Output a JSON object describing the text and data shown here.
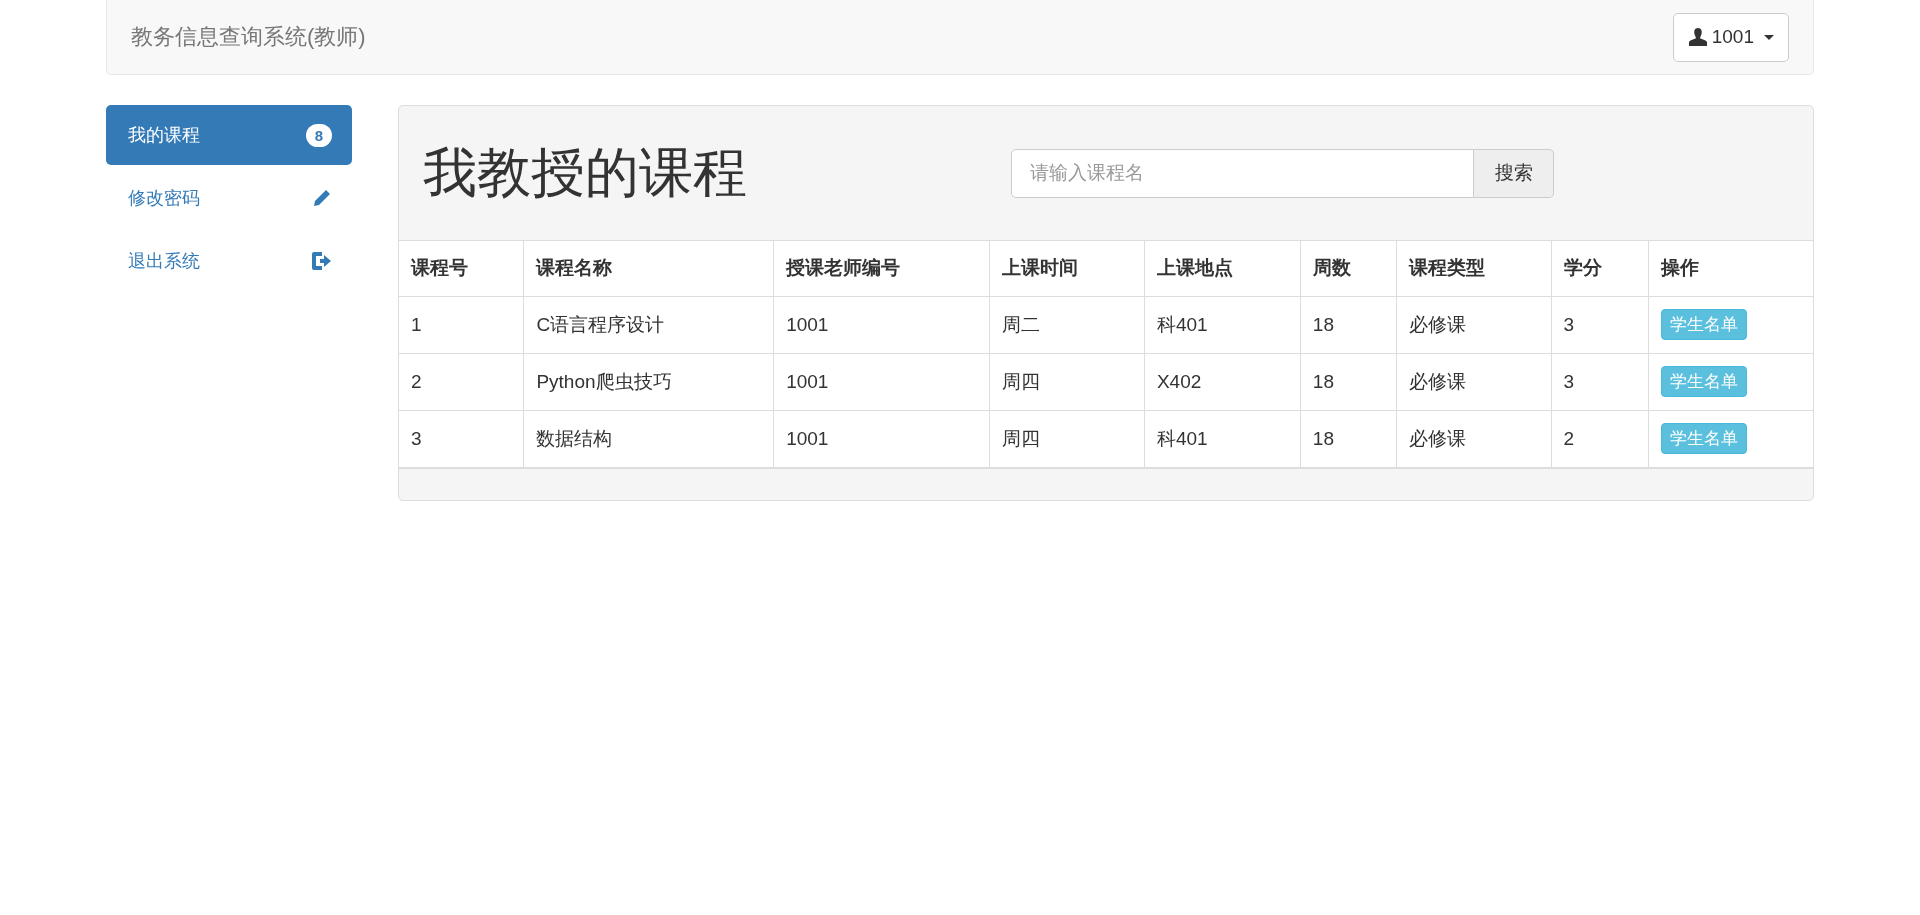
{
  "navbar": {
    "brand": "教务信息查询系统(教师)",
    "user_menu": {
      "label": "1001"
    }
  },
  "sidebar": {
    "items": [
      {
        "label": "我的课程",
        "kind": "count",
        "badge": "8",
        "selected": true
      },
      {
        "label": "修改密码",
        "kind": "edit",
        "selected": false
      },
      {
        "label": "退出系统",
        "kind": "logout",
        "selected": false
      }
    ]
  },
  "panel": {
    "title": "我教授的课程",
    "search": {
      "placeholder": "请输入课程名",
      "button": "搜索"
    },
    "table": {
      "columns": [
        "课程号",
        "课程名称",
        "授课老师编号",
        "上课时间",
        "上课地点",
        "周数",
        "课程类型",
        "学分",
        "操作"
      ],
      "rows": [
        {
          "cells": [
            "1",
            "C语言程序设计",
            "1001",
            "周二",
            "科401",
            "18",
            "必修课",
            "3"
          ],
          "action": "学生名单"
        },
        {
          "cells": [
            "2",
            "Python爬虫技巧",
            "1001",
            "周四",
            "X402",
            "18",
            "必修课",
            "3"
          ],
          "action": "学生名单"
        },
        {
          "cells": [
            "3",
            "数据结构",
            "1001",
            "周四",
            "科401",
            "18",
            "必修课",
            "2"
          ],
          "action": "学生名单"
        }
      ]
    }
  }
}
